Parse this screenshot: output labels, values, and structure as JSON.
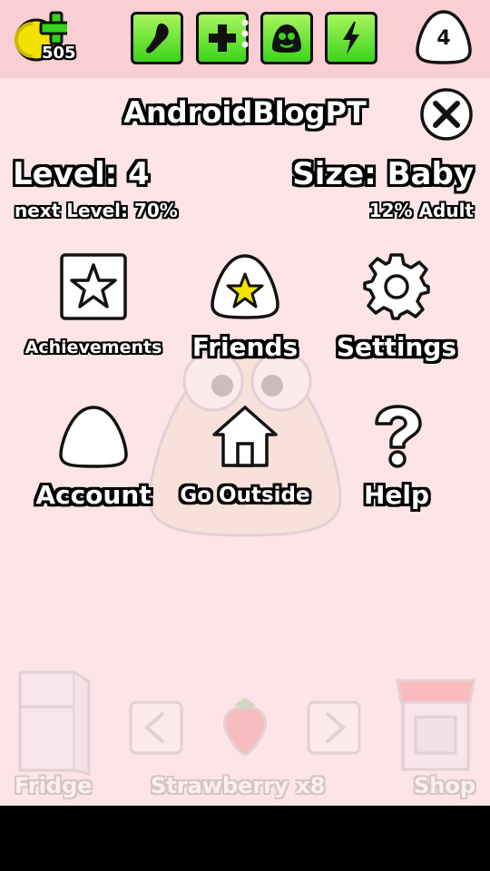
{
  "header": {
    "coins": "505",
    "level_bubble": "4",
    "stat_buttons": [
      {
        "icon": "drumstick-icon"
      },
      {
        "icon": "plus-icon"
      },
      {
        "icon": "pou-face-icon"
      },
      {
        "icon": "lightning-icon"
      }
    ]
  },
  "profile": {
    "username": "AndroidBlogPT",
    "level_label": "Level: 4",
    "size_label": "Size: Baby",
    "next_level_label": "next Level: 70%",
    "next_level_progress": 0.7,
    "adult_label": "12% Adult"
  },
  "menu": {
    "achievements": "Achievements",
    "friends": "Friends",
    "settings": "Settings",
    "account": "Account",
    "go_outside": "Go Outside",
    "help": "Help"
  },
  "background": {
    "fridge_label": "Fridge",
    "food_label": "Strawberry x8",
    "shop_label": "Shop"
  },
  "colors": {
    "panel_bg": "#fde4e7",
    "topbar_bg": "#f9cfd3",
    "stat_green": "#3bd41c",
    "coin_yellow": "#f3e200"
  }
}
